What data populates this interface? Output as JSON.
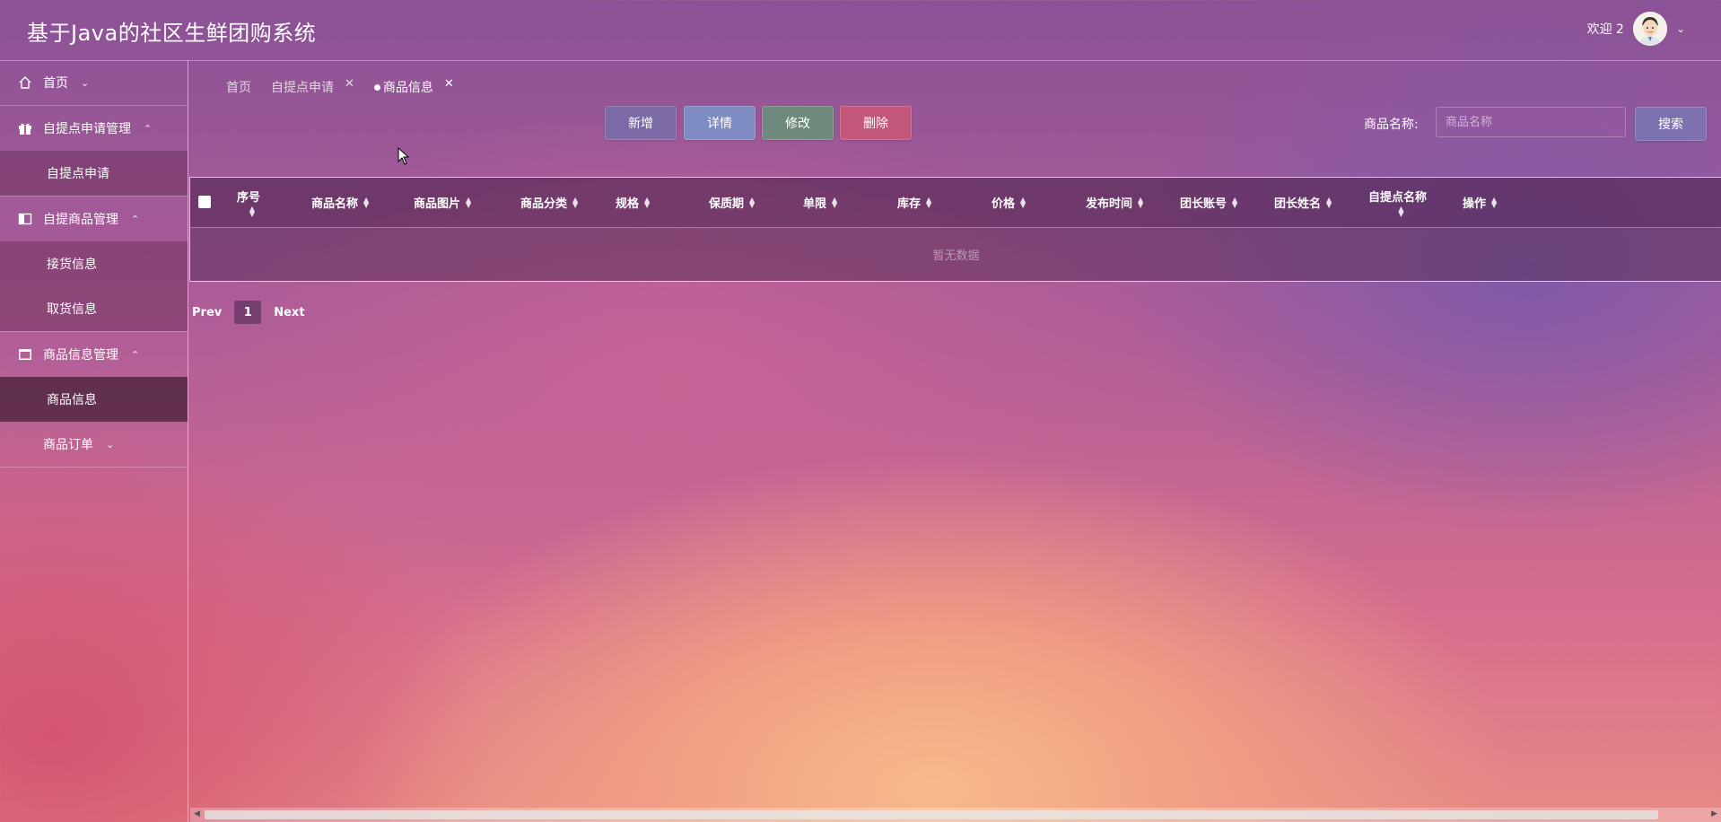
{
  "header": {
    "title": "基于Java的社区生鲜团购系统",
    "welcome": "欢迎 2"
  },
  "sidebar": {
    "groups": [
      {
        "label": "首页",
        "icon": "home-icon",
        "subs": []
      },
      {
        "label": "自提点申请管理",
        "icon": "gift-icon",
        "subs": [
          {
            "label": "自提点申请"
          }
        ]
      },
      {
        "label": "自提商品管理",
        "icon": "panel-icon",
        "subs": [
          {
            "label": "接货信息"
          },
          {
            "label": "取货信息"
          }
        ]
      },
      {
        "label": "商品信息管理",
        "icon": "box-icon",
        "subs": [
          {
            "label": "商品信息",
            "active": true
          },
          {
            "label": "商品订单"
          }
        ]
      }
    ]
  },
  "tabs": [
    {
      "label": "首页"
    },
    {
      "label": "自提点申请",
      "closable": true
    },
    {
      "label": "商品信息",
      "closable": true,
      "active": true
    }
  ],
  "toolbar": {
    "add": "新增",
    "detail": "详情",
    "edit": "修改",
    "delete": "删除",
    "search_label": "商品名称:",
    "search_placeholder": "商品名称",
    "search_button": "搜索"
  },
  "table": {
    "columns": [
      "序号",
      "商品名称",
      "商品图片",
      "商品分类",
      "规格",
      "保质期",
      "单限",
      "库存",
      "价格",
      "发布时间",
      "团长账号",
      "团长姓名",
      "自提点名称",
      "操作"
    ],
    "empty_text": "暂无数据"
  },
  "pager": {
    "prev": "Prev",
    "page": "1",
    "next": "Next"
  },
  "colors": {
    "add": "#7b6aa6",
    "detail": "#7f8cc4",
    "edit": "#6f8a7c",
    "delete": "#c35779",
    "search": "#7e71b0"
  }
}
